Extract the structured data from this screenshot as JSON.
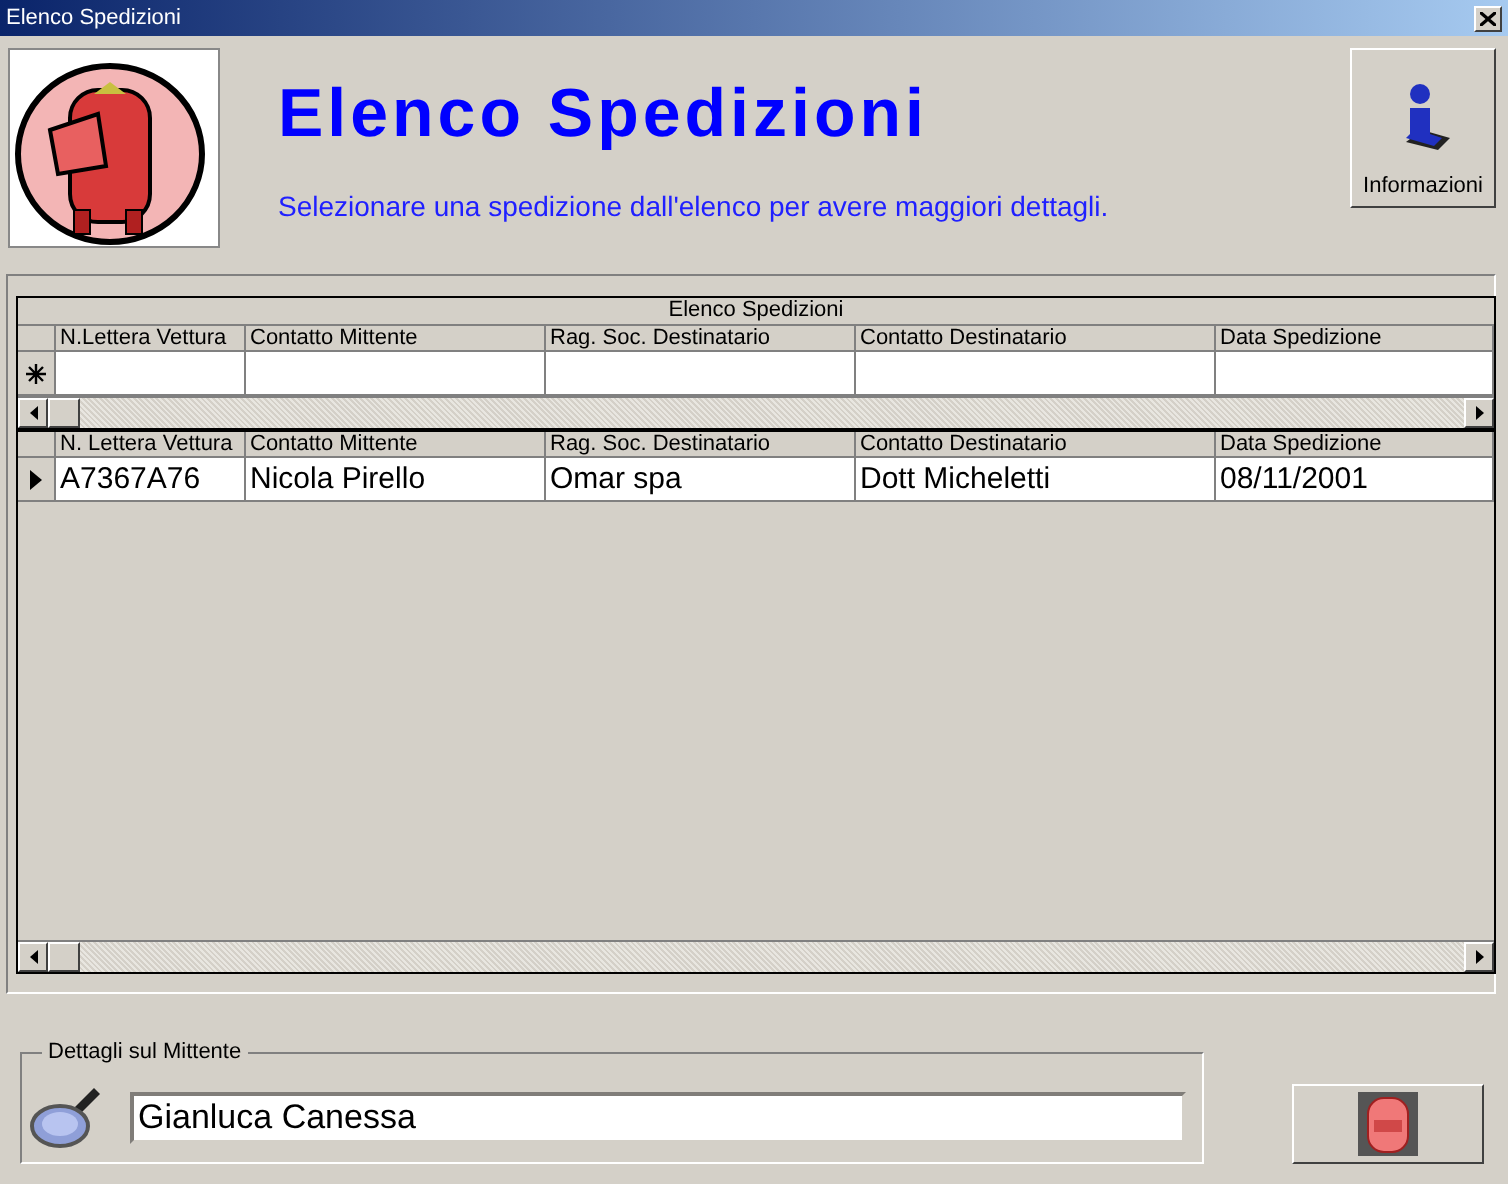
{
  "window": {
    "title": "Elenco Spedizioni"
  },
  "header": {
    "title": "Elenco Spedizioni",
    "subtitle": "Selezionare una spedizione dall'elenco per avere maggiori dettagli.",
    "info_button": "Informazioni"
  },
  "filter_grid": {
    "caption": "Elenco Spedizioni",
    "columns": [
      "N.Lettera Vettura",
      "Contatto Mittente",
      "Rag. Soc. Destinatario",
      "Contatto Destinatario",
      "Data Spedizione"
    ]
  },
  "table": {
    "columns": [
      "N. Lettera Vettura",
      "Contatto Mittente",
      "Rag. Soc. Destinatario",
      "Contatto Destinatario",
      "Data Spedizione"
    ],
    "rows": [
      {
        "cells": [
          "A7367A76",
          "Nicola Pirello",
          "Omar spa",
          "Dott Micheletti",
          "08/11/2001"
        ],
        "selected": true
      }
    ]
  },
  "sender_details": {
    "legend": "Dettagli sul Mittente",
    "value": "Gianluca Canessa"
  }
}
